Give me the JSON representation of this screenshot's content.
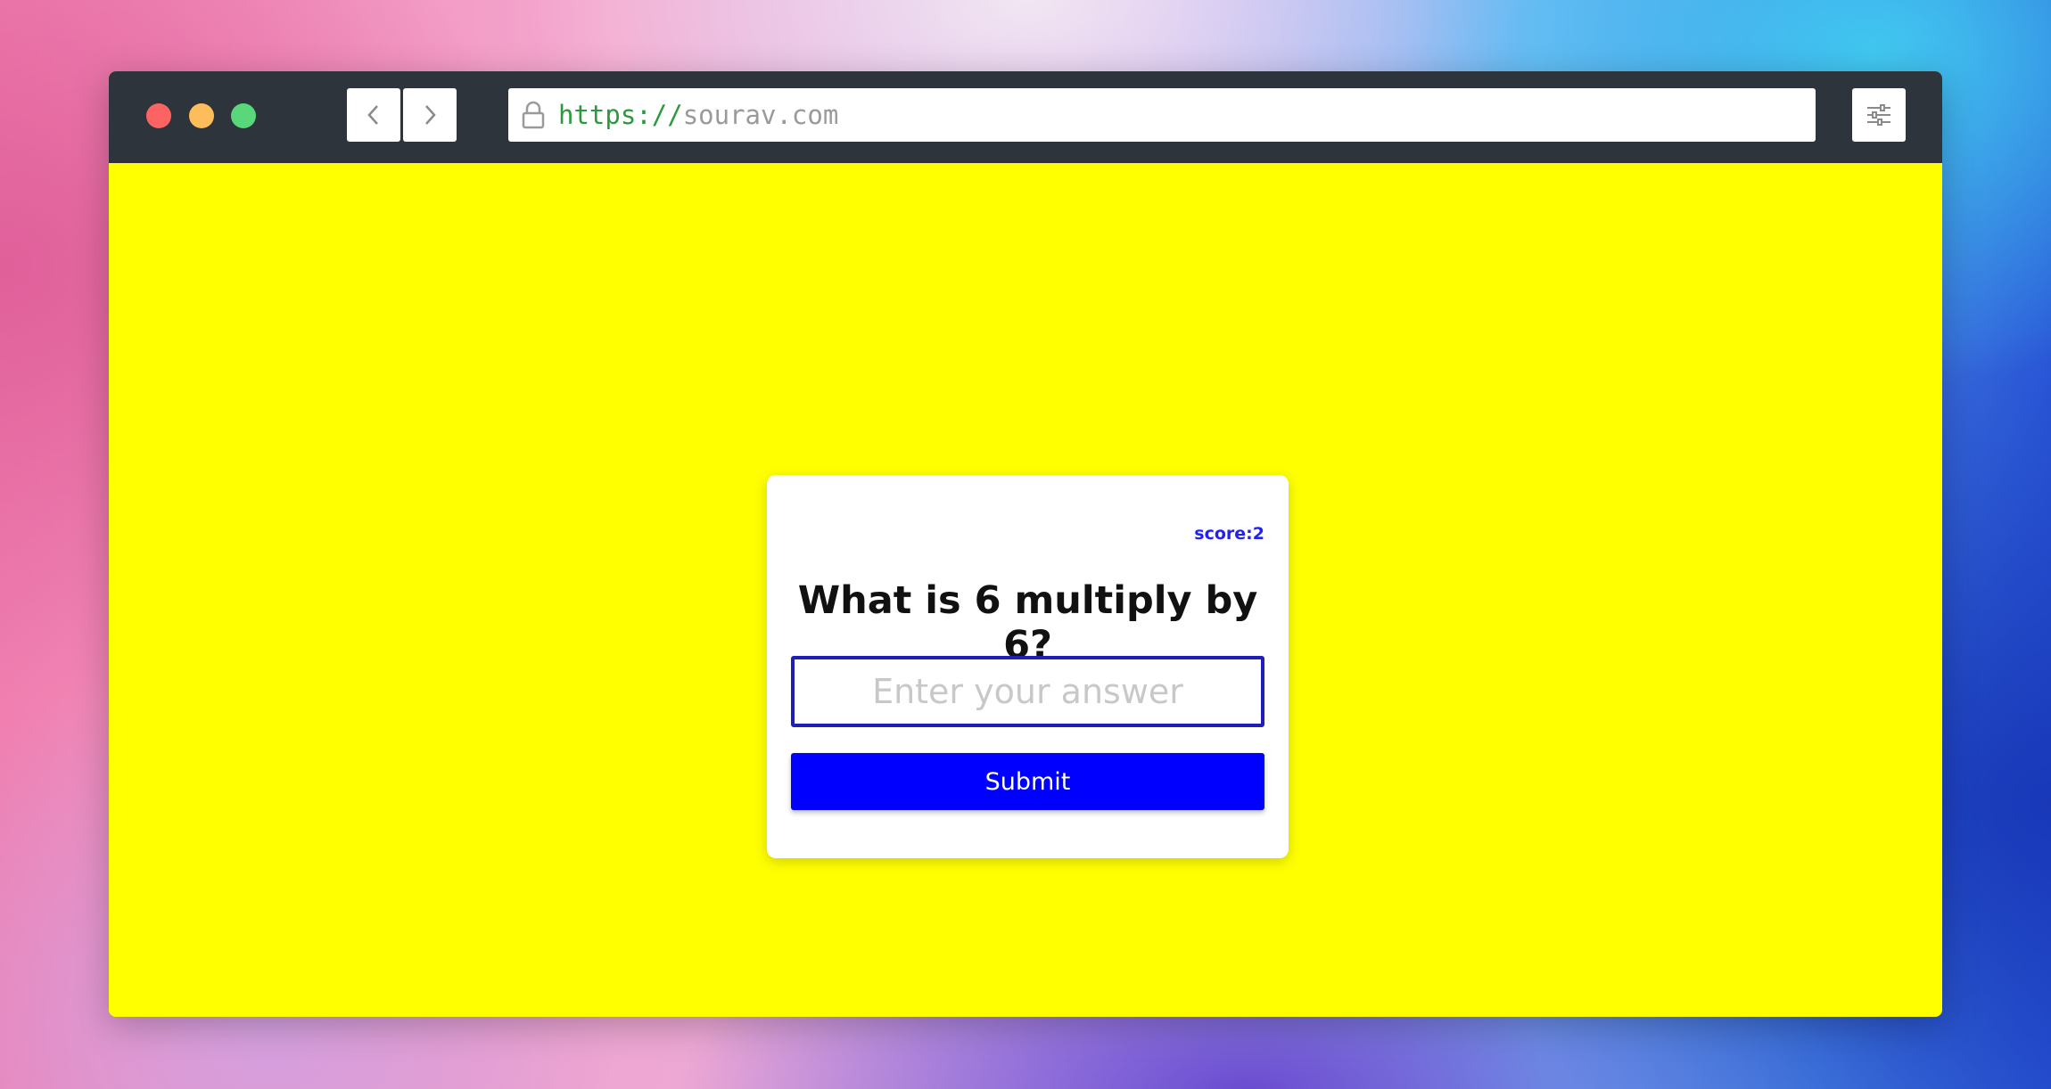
{
  "browser": {
    "url_scheme": "https://",
    "url_host": "sourav.com",
    "controls": {
      "close_color": "#fc6363",
      "minimize_color": "#fdbd5a",
      "maximize_color": "#58d87a"
    },
    "icons": {
      "back": "chevron-left-icon",
      "forward": "chevron-right-icon",
      "lock": "lock-icon",
      "settings": "sliders-icon"
    }
  },
  "page": {
    "background_color": "#ffff00",
    "quiz": {
      "score_text": "score:2",
      "question": "What is 6 multiply by 6?",
      "answer_placeholder": "Enter your answer",
      "answer_value": "",
      "submit_label": "Submit",
      "accent_color": "#0000ff"
    }
  }
}
